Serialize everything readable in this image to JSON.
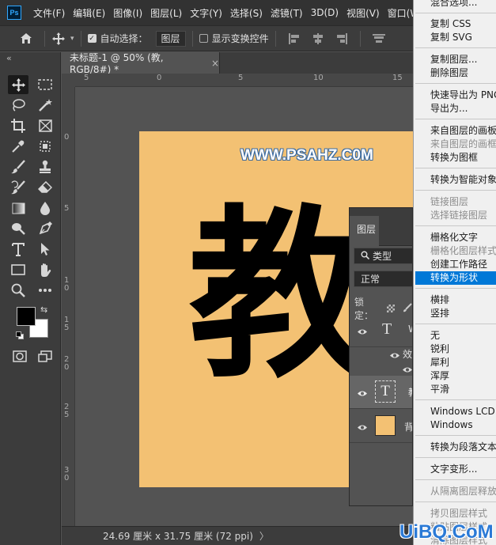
{
  "app": {
    "logo": "Ps"
  },
  "menubar": {
    "items": [
      "文件(F)",
      "编辑(E)",
      "图像(I)",
      "图层(L)",
      "文字(Y)",
      "选择(S)",
      "滤镜(T)",
      "3D(D)",
      "视图(V)",
      "窗口(W)"
    ]
  },
  "options": {
    "auto_select_label": "自动选择：",
    "auto_select_checked": true,
    "auto_select_target": "图层",
    "show_transform_label": "显示变换控件",
    "show_transform_checked": false
  },
  "tools": {
    "collapse": "«",
    "items": [
      "move-tool",
      "marquee-tool",
      "lasso-tool",
      "magic-wand-tool",
      "crop-tool",
      "frame-tool",
      "eyedropper-tool",
      "object-selection-tool",
      "brush-tool",
      "stamp-tool",
      "history-brush-tool",
      "eraser-tool",
      "gradient-tool",
      "blur-tool",
      "dodge-tool",
      "pen-tool",
      "type-tool",
      "path-selection-tool",
      "rectangle-tool",
      "hand-tool",
      "zoom-tool",
      "more-tool"
    ],
    "foreground_color": "#000000",
    "background_color": "#ffffff"
  },
  "document": {
    "tab_title": "未标题-1 @ 50% (教, RGB/8#) *",
    "close": "×",
    "ruler_top_labels": [
      "5",
      "0",
      "5",
      "10",
      "15"
    ],
    "ruler_left_labels": [
      "0",
      "5",
      "1 0",
      "1 5",
      "2 0",
      "2 5",
      "3 0"
    ],
    "canvas_color": "#f3c173",
    "watermark": "WWW.PSAHZ.C0M",
    "big_text": "教"
  },
  "status": {
    "text": "24.69 厘米 x 31.75 厘米 (72 ppi)",
    "arrow": "〉"
  },
  "layers_panel": {
    "tab": "图层",
    "filter_label": "类型",
    "blend_mode": "正常",
    "lock_label": "锁定：",
    "layers": [
      {
        "name": "W",
        "type": "text"
      },
      {
        "name": "效",
        "type": "effects"
      },
      {
        "name": "教",
        "type": "text",
        "selected": true
      },
      {
        "name": "背",
        "type": "background",
        "color": "#f3c173"
      }
    ]
  },
  "context_menu": {
    "items": [
      {
        "label": "混合选项...",
        "disabled": false
      },
      {
        "label": "复制 CSS",
        "disabled": false
      },
      {
        "label": "复制 SVG",
        "disabled": false
      },
      {
        "label": "复制图层...",
        "disabled": false
      },
      {
        "label": "删除图层",
        "disabled": false
      },
      {
        "label": "快速导出为 PNG",
        "disabled": false
      },
      {
        "label": "导出为...",
        "disabled": false
      },
      {
        "label": "来自图层的画板...",
        "disabled": false
      },
      {
        "label": "来自图层的画框...",
        "disabled": true
      },
      {
        "label": "转换为图框",
        "disabled": false
      },
      {
        "label": "转换为智能对象",
        "disabled": false
      },
      {
        "label": "链接图层",
        "disabled": true
      },
      {
        "label": "选择链接图层",
        "disabled": true
      },
      {
        "label": "栅格化文字",
        "disabled": false
      },
      {
        "label": "栅格化图层样式",
        "disabled": true
      },
      {
        "label": "创建工作路径",
        "disabled": false
      },
      {
        "label": "转换为形状",
        "disabled": false,
        "highlighted": true
      },
      {
        "label": "横排",
        "disabled": false
      },
      {
        "label": "竖排",
        "disabled": false
      },
      {
        "label": "无",
        "disabled": false
      },
      {
        "label": "锐利",
        "disabled": false
      },
      {
        "label": "犀利",
        "disabled": false
      },
      {
        "label": "浑厚",
        "disabled": false
      },
      {
        "label": "平滑",
        "disabled": false
      },
      {
        "label": "Windows LCD",
        "disabled": false
      },
      {
        "label": "Windows",
        "disabled": false
      },
      {
        "label": "转换为段落文本",
        "disabled": false
      },
      {
        "label": "文字变形...",
        "disabled": false
      },
      {
        "label": "从隔离图层释放",
        "disabled": true
      },
      {
        "label": "拷贝图层样式",
        "disabled": true
      },
      {
        "label": "粘贴图层样式",
        "disabled": true
      },
      {
        "label": "清除图层样式",
        "disabled": true
      }
    ],
    "highlight_color": "#0078d7"
  },
  "brand": "UiBQ.CoM"
}
